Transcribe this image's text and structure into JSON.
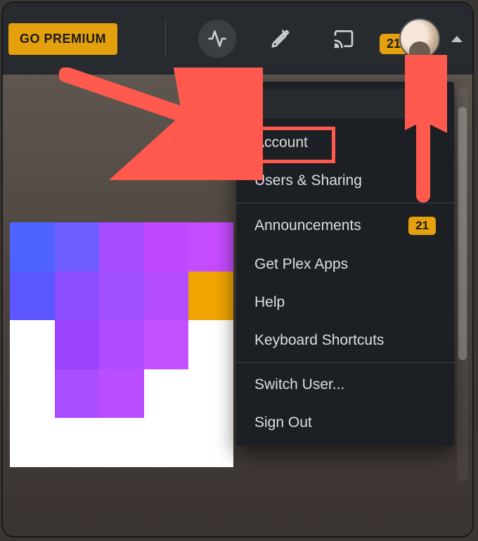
{
  "topbar": {
    "premium_label": "GO PREMIUM",
    "notification_count": "21"
  },
  "menu": {
    "section1": [
      {
        "label": "Account"
      },
      {
        "label": "Users & Sharing"
      }
    ],
    "section2": [
      {
        "label": "Announcements",
        "badge": "21"
      },
      {
        "label": "Get Plex Apps"
      },
      {
        "label": "Help"
      },
      {
        "label": "Keyboard Shortcuts"
      }
    ],
    "section3": [
      {
        "label": "Switch User..."
      },
      {
        "label": "Sign Out"
      }
    ]
  },
  "colors": {
    "accent": "#e5a00d",
    "annotation": "#ff5a4d"
  }
}
